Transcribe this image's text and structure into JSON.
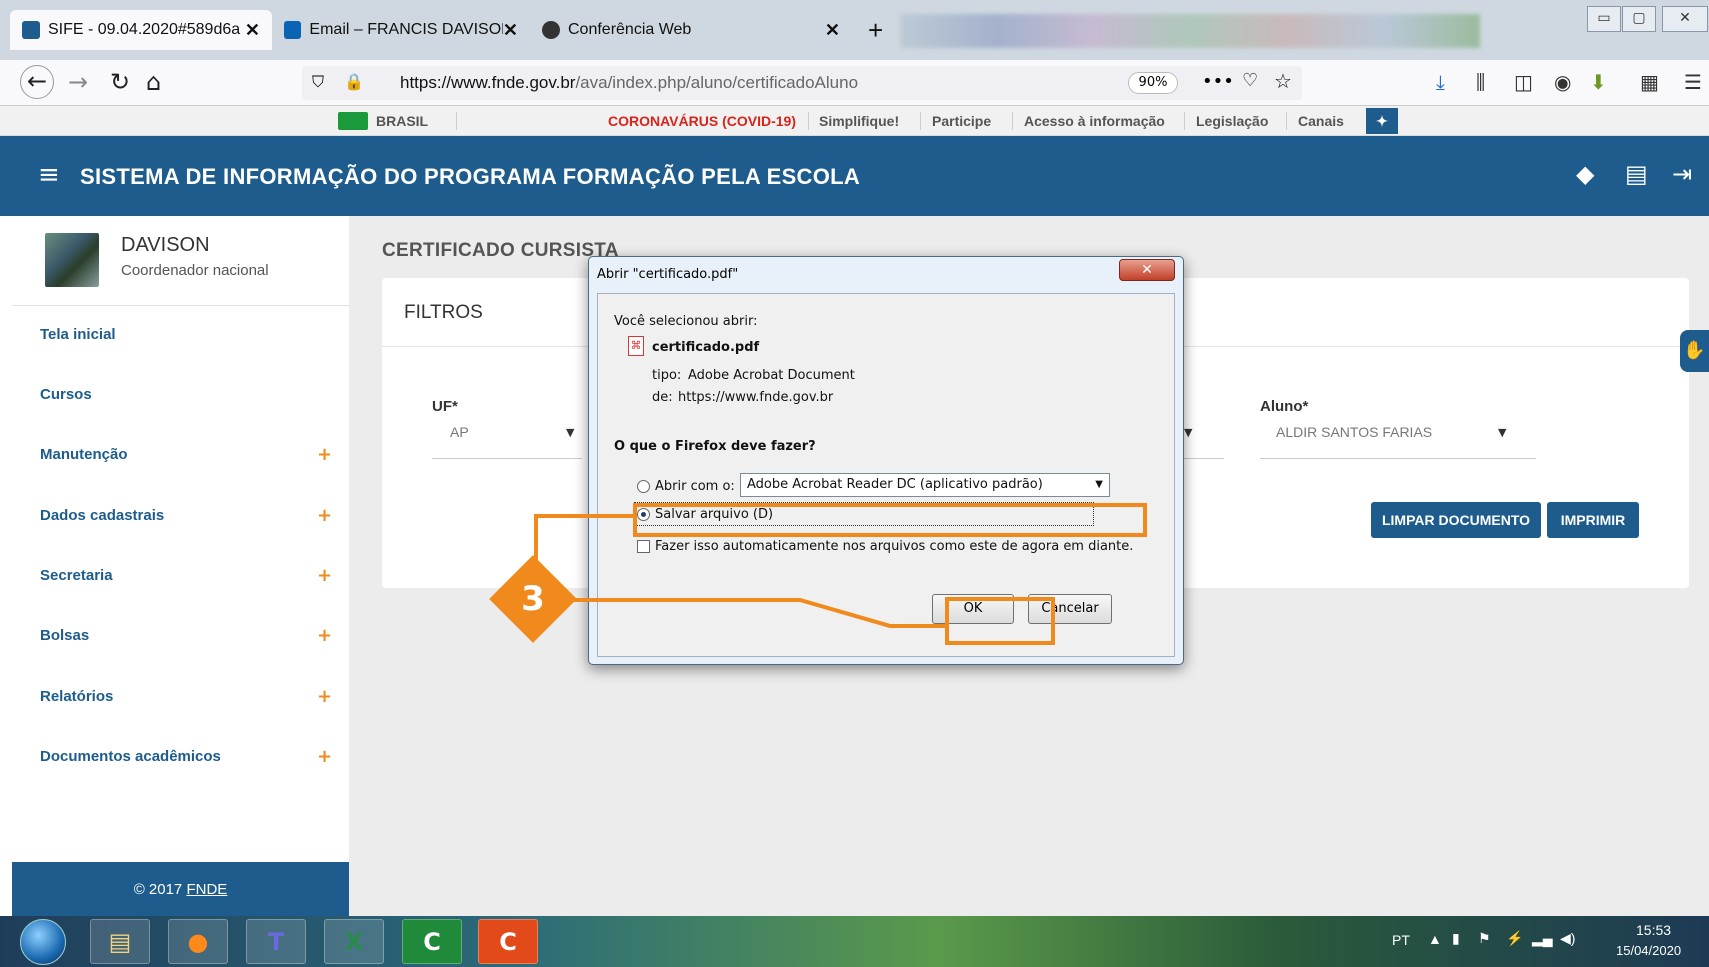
{
  "browser": {
    "tabs": [
      {
        "title": "SIFE - 09.04.2020#589d6a",
        "active": true
      },
      {
        "title": "Email – FRANCIS DAVISON DA"
      },
      {
        "title": "Conferência Web"
      }
    ],
    "tab_close": "✕",
    "new_tab": "+",
    "url_domain": "https://www.fnde.gov.br",
    "url_path": "/ava/index.php/aluno/certificadoAluno",
    "zoom": "90%"
  },
  "govbar": {
    "brasil": "BRASIL",
    "links": [
      "CORONAVÁRUS (COVID-19)",
      "Simplifique!",
      "Participe",
      "Acesso à informação",
      "Legislação",
      "Canais"
    ]
  },
  "app": {
    "title": "SISTEMA DE INFORMAÇÃO DO PROGRAMA FORMAÇÃO PELA ESCOLA"
  },
  "profile": {
    "name": "DAVISON",
    "role": "Coordenador nacional"
  },
  "sidebar": {
    "items": [
      {
        "label": "Tela inicial"
      },
      {
        "label": "Cursos"
      },
      {
        "label": "Manutenção"
      },
      {
        "label": "Dados cadastrais"
      },
      {
        "label": "Secretaria"
      },
      {
        "label": "Bolsas"
      },
      {
        "label": "Relatórios"
      },
      {
        "label": "Documentos acadêmicos"
      }
    ],
    "expand": "+"
  },
  "footer": {
    "copyright": "© 2017",
    "link": "FNDE"
  },
  "main": {
    "page_title": "CERTIFICADO CURSISTA",
    "filters_title": "FILTROS",
    "uf_label": "UF*",
    "uf_value": "AP",
    "aluno_label": "Aluno*",
    "aluno_value": "ALDIR SANTOS FARIAS",
    "btn_clear": "LIMPAR DOCUMENTO",
    "btn_print": "IMPRIMIR"
  },
  "dialog": {
    "title": "Abrir \"certificado.pdf\"",
    "close": "✕",
    "intro": "Você selecionou abrir:",
    "filename": "certificado.pdf",
    "type_label": "tipo:",
    "type_value": "Adobe Acrobat Document",
    "from_label": "de:",
    "from_value": "https://www.fnde.gov.br",
    "question": "O que o Firefox deve fazer?",
    "open_with_label": "Abrir com o:",
    "open_with_value": "Adobe Acrobat Reader DC  (aplicativo padrão)",
    "save_label": "Salvar arquivo (D)",
    "auto_label": "Fazer isso automaticamente nos arquivos como este de agora em diante.",
    "ok": "OK",
    "cancel": "Cancelar"
  },
  "annotation": {
    "step": "3",
    "color": "#f08a1c"
  },
  "taskbar": {
    "lang": "PT",
    "time": "15:53",
    "date": "15/04/2020"
  },
  "colors": {
    "brand": "#1d5c8c",
    "accent": "#f08a1c"
  }
}
